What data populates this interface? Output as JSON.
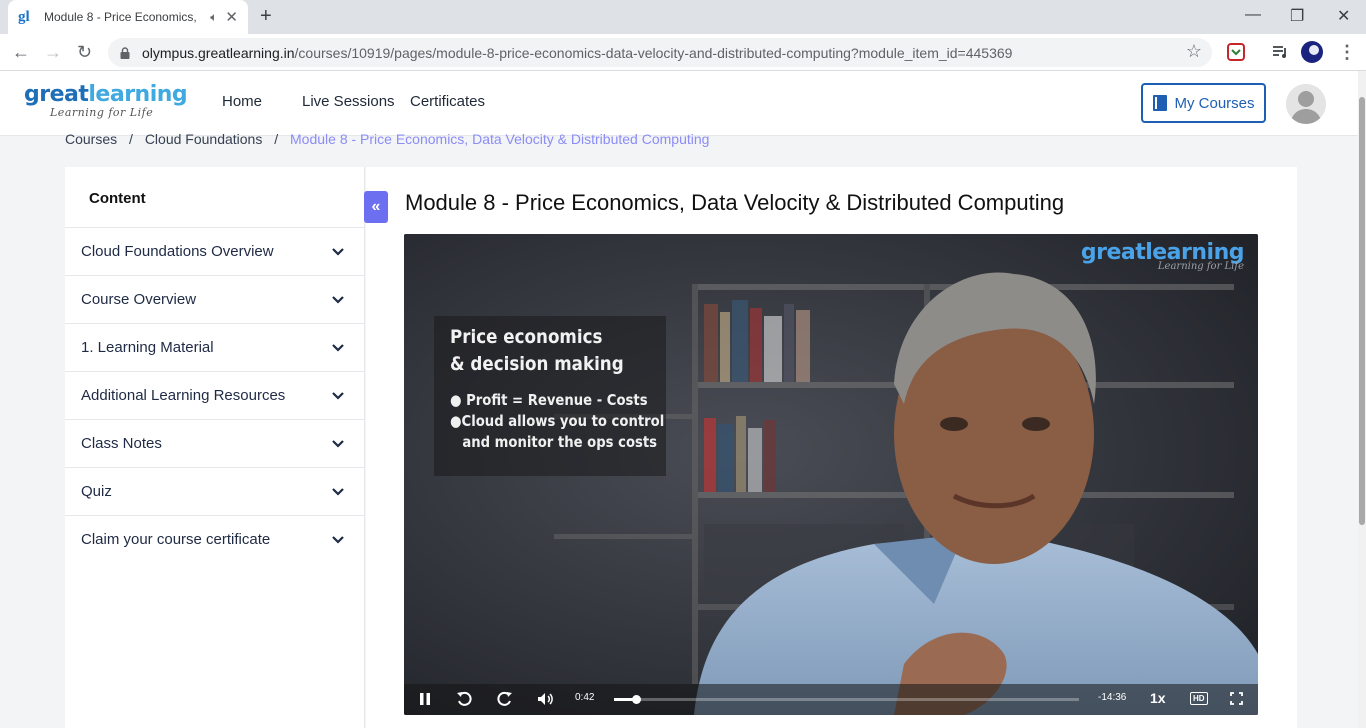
{
  "browser": {
    "tab_title": "Module 8 - Price Economics,",
    "favicon": "gl",
    "url_host": "olympus.greatlearning.in",
    "url_path": "/courses/10919/pages/module-8-price-economics-data-velocity-and-distributed-computing?module_item_id=445369"
  },
  "header": {
    "logo_great": "great",
    "logo_learning": "learning",
    "logo_tagline": "Learning for Life",
    "nav": [
      "Home",
      "Live Sessions",
      "Certificates"
    ],
    "my_courses": "My Courses"
  },
  "breadcrumb": {
    "items": [
      "Courses",
      "Cloud Foundations"
    ],
    "current": "Module 8 - Price Economics, Data Velocity & Distributed Computing",
    "separator": "/"
  },
  "sidebar": {
    "heading": "Content",
    "collapse_icon": "«",
    "modules": [
      "Cloud Foundations Overview",
      "Course Overview",
      "1. Learning Material",
      "Additional Learning Resources",
      "Class Notes",
      "Quiz",
      "Claim your course certificate"
    ]
  },
  "main": {
    "title": "Module 8 - Price Economics, Data Velocity & Distributed Computing"
  },
  "video": {
    "slide_title_1": "Price economics",
    "slide_title_2": "& decision making",
    "bullet_1": "● Profit = Revenue - Costs",
    "bullet_2": "●Cloud allows you to control",
    "bullet_3": "and monitor the ops costs",
    "watermark": "greatlearning",
    "watermark_tag": "Learning for Life",
    "elapsed": "0:42",
    "remaining": "-14:36",
    "speed": "1x",
    "progress": 0.047,
    "hd_label": "HD"
  },
  "colors": {
    "accent": "#6b6ff0",
    "brand_blue": "#1e5fb4",
    "breadcrumb_current": "#8b8cf6"
  }
}
